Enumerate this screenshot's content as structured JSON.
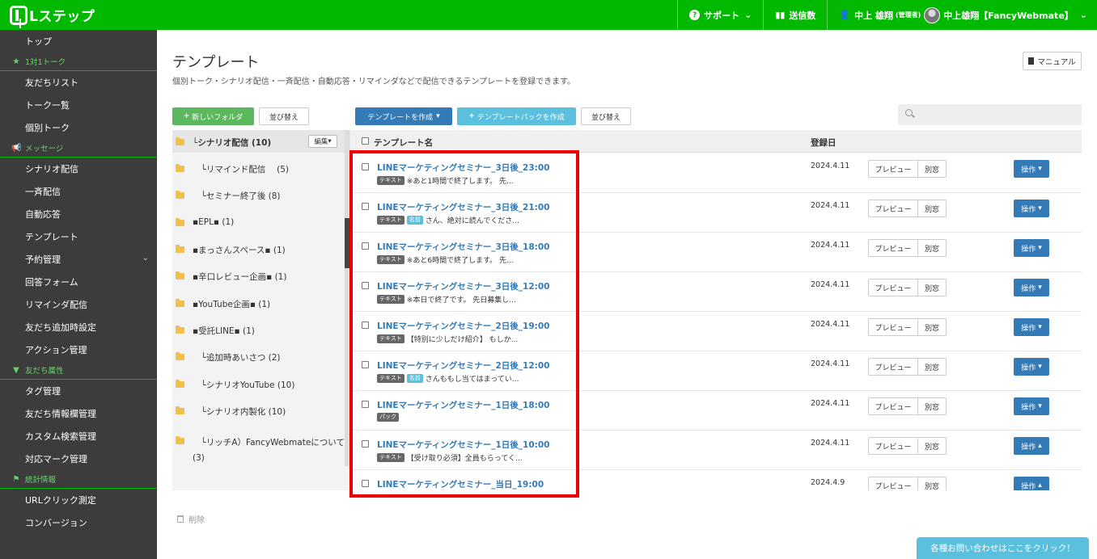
{
  "header": {
    "logo": "Lステップ",
    "support": "サポート",
    "send_count": "送信数",
    "admin_user": "中上 雄翔",
    "admin_role": "(管理者)",
    "account": "中上雄翔【FancyWebmate】"
  },
  "sidebar": {
    "items": [
      {
        "type": "item",
        "label": "トップ"
      },
      {
        "type": "head",
        "label": "1対1トーク",
        "icon": "star-icon"
      },
      {
        "type": "item",
        "label": "友だちリスト"
      },
      {
        "type": "item",
        "label": "トーク一覧"
      },
      {
        "type": "item",
        "label": "個別トーク"
      },
      {
        "type": "head",
        "label": "メッセージ",
        "icon": "megaphone-icon"
      },
      {
        "type": "item",
        "label": "シナリオ配信"
      },
      {
        "type": "item",
        "label": "一斉配信"
      },
      {
        "type": "item",
        "label": "自動応答"
      },
      {
        "type": "item",
        "label": "テンプレート"
      },
      {
        "type": "item",
        "label": "予約管理",
        "chevron": true
      },
      {
        "type": "item",
        "label": "回答フォーム"
      },
      {
        "type": "item",
        "label": "リマインダ配信"
      },
      {
        "type": "item",
        "label": "友だち追加時設定"
      },
      {
        "type": "item",
        "label": "アクション管理"
      },
      {
        "type": "head",
        "label": "友だち属性",
        "icon": "filter-icon"
      },
      {
        "type": "item",
        "label": "タグ管理"
      },
      {
        "type": "item",
        "label": "友だち情報欄管理"
      },
      {
        "type": "item",
        "label": "カスタム検索管理"
      },
      {
        "type": "item",
        "label": "対応マーク管理"
      },
      {
        "type": "head",
        "label": "統計情報",
        "icon": "flag-icon"
      },
      {
        "type": "item",
        "label": "URLクリック測定"
      },
      {
        "type": "item",
        "label": "コンバージョン"
      }
    ]
  },
  "page": {
    "title": "テンプレート",
    "description": "個別トーク・シナリオ配信・一斉配信・自動応答・リマインダなどで配信できるテンプレートを登録できます。",
    "manual": "マニュアル"
  },
  "toolbar": {
    "new_folder": "新しいフォルダ",
    "sort_folders": "並び替え",
    "create_template": "テンプレートを作成",
    "create_pack": "テンプレートパックを作成",
    "sort_templates": "並び替え",
    "search_placeholder": ""
  },
  "folders": {
    "edit_label": "編集",
    "delete_label": "削除",
    "items": [
      {
        "label": "└シナリオ配信 (10)",
        "selected": true
      },
      {
        "label": "　└リマインド配信　 (5)"
      },
      {
        "label": "　└セミナー終了後 (8)"
      },
      {
        "label": "▪EPL▪ (1)"
      },
      {
        "label": "▪まっさんスペース▪ (1)"
      },
      {
        "label": "▪辛口レビュー企画▪ (1)"
      },
      {
        "label": "▪YouTube企画▪ (1)"
      },
      {
        "label": "▪受託LINE▪ (1)"
      },
      {
        "label": "　└追加時あいさつ (2)"
      },
      {
        "label": "　└シナリオYouTube (10)"
      },
      {
        "label": "　└シナリオ内製化 (10)"
      },
      {
        "label": "　└リッチA）FancyWebmateについて (3)"
      }
    ]
  },
  "table": {
    "col_name": "テンプレート名",
    "col_date": "登録日",
    "preview": "プレビュー",
    "separate": "別窓",
    "operation": "操作",
    "rows": [
      {
        "name": "LINEマーケティングセミナー_3日後_23:00",
        "tags": [
          "テキスト"
        ],
        "desc": "※あと1時間で終了します。 先...",
        "date": "2024.4.11",
        "caret": "▾"
      },
      {
        "name": "LINEマーケティングセミナー_3日後_21:00",
        "tags": [
          "テキスト",
          "名前"
        ],
        "desc": "さん、絶対に読んでくださ...",
        "date": "2024.4.11",
        "caret": "▾"
      },
      {
        "name": "LINEマーケティングセミナー_3日後_18:00",
        "tags": [
          "テキスト"
        ],
        "desc": "※あと6時間で終了します。 先...",
        "date": "2024.4.11",
        "caret": "▾"
      },
      {
        "name": "LINEマーケティングセミナー_3日後_12:00",
        "tags": [
          "テキスト"
        ],
        "desc": "※本日で終了です。 先日募集し...",
        "date": "2024.4.11",
        "caret": "▾"
      },
      {
        "name": "LINEマーケティングセミナー_2日後_19:00",
        "tags": [
          "テキスト"
        ],
        "desc": "【特別に少しだけ紹介】 もしか...",
        "date": "2024.4.11",
        "caret": "▾"
      },
      {
        "name": "LINEマーケティングセミナー_2日後_12:00",
        "tags": [
          "テキスト",
          "名前"
        ],
        "desc": "さんももし当てはまってい...",
        "date": "2024.4.11",
        "caret": "▾"
      },
      {
        "name": "LINEマーケティングセミナー_1日後_18:00",
        "tags": [
          "パック"
        ],
        "desc": "",
        "date": "2024.4.11",
        "caret": "▾"
      },
      {
        "name": "LINEマーケティングセミナー_1日後_10:00",
        "tags": [
          "テキスト"
        ],
        "desc": "【受け取り必須】全員もらってく...",
        "date": "2024.4.11",
        "caret": "▴"
      },
      {
        "name": "LINEマーケティングセミナー_当日_19:00",
        "tags": [],
        "desc": "",
        "date": "2024.4.9",
        "caret": "▴"
      }
    ]
  },
  "footer": {
    "contact": "各種お問い合わせはここをクリック！"
  },
  "colors": {
    "brand_green": "#00b900",
    "link_blue": "#337ab7",
    "highlight_red": "#e00000"
  }
}
